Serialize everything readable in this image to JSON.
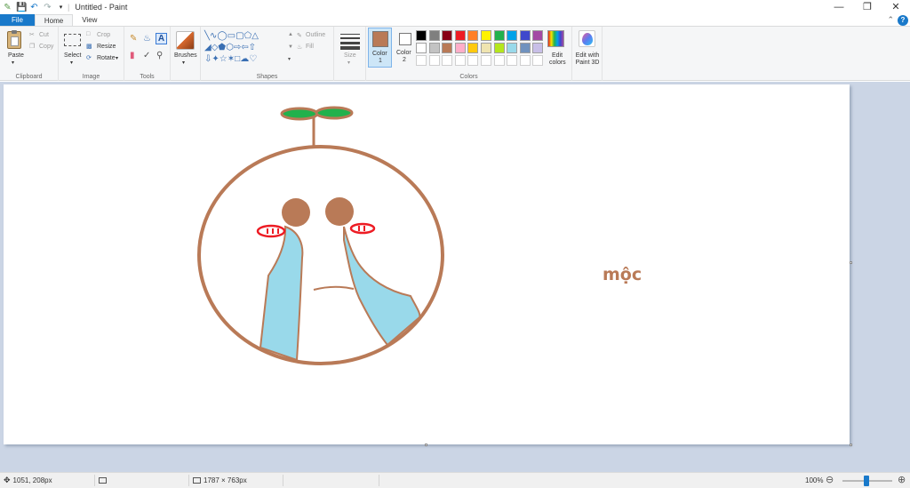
{
  "window": {
    "title": "Untitled - Paint",
    "controls": [
      "minimize",
      "maximize",
      "close"
    ]
  },
  "tabs": [
    {
      "label": "File"
    },
    {
      "label": "Home"
    },
    {
      "label": "View"
    }
  ],
  "ribbon": {
    "clipboard": {
      "group_label": "Clipboard",
      "paste": "Paste",
      "cut": "Cut",
      "copy": "Copy"
    },
    "image": {
      "group_label": "Image",
      "select": "Select",
      "crop": "Crop",
      "resize": "Resize",
      "rotate": "Rotate"
    },
    "tools": {
      "group_label": "Tools"
    },
    "brushes": {
      "label": "Brushes"
    },
    "shapes": {
      "group_label": "Shapes",
      "outline": "Outline",
      "fill": "Fill"
    },
    "size": {
      "label": "Size"
    },
    "color1": {
      "label": "Color",
      "number": "1",
      "color": "#b97a57"
    },
    "color2": {
      "label": "Color",
      "number": "2",
      "color": "#ffffff"
    },
    "colors": {
      "group_label": "Colors",
      "row1": [
        "#000000",
        "#7f7f7f",
        "#880015",
        "#ed1c24",
        "#ff7f27",
        "#fff200",
        "#22b14c",
        "#00a2e8",
        "#3f48cc",
        "#a349a4"
      ],
      "row2": [
        "#ffffff",
        "#c3c3c3",
        "#b97a57",
        "#ffaec9",
        "#ffc90e",
        "#efe4b0",
        "#b5e61d",
        "#99d9ea",
        "#7092be",
        "#c8bfe7"
      ]
    },
    "edit_colors": "Edit colors",
    "edit_paint3d": "Edit with Paint 3D"
  },
  "canvas": {
    "text": "mộc",
    "drawing_colors": {
      "outline": "#b97a57",
      "tears": "#99d9ea",
      "eyes_red": "#ed1c24",
      "leaf_green": "#22b14c"
    }
  },
  "status": {
    "cursor_pos": "1051, 208px",
    "canvas_size": "1787 × 763px",
    "zoom": "100%"
  }
}
